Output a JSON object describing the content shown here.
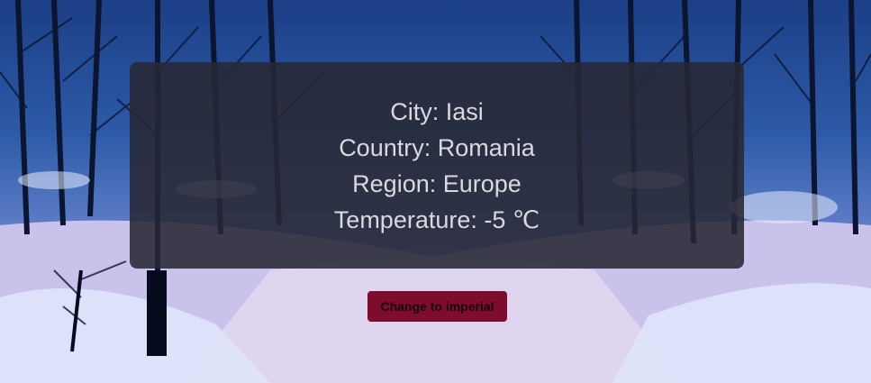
{
  "weather": {
    "city_line": "City: Iasi",
    "country_line": "Country: Romania",
    "region_line": "Region: Europe",
    "temperature_line": "Temperature: -5 ℃"
  },
  "controls": {
    "toggle_units_label": "Change to imperial"
  },
  "colors": {
    "card_background": "#282834",
    "text": "#d9d9de",
    "button_background": "#7e0c2e",
    "button_text": "#140409"
  }
}
